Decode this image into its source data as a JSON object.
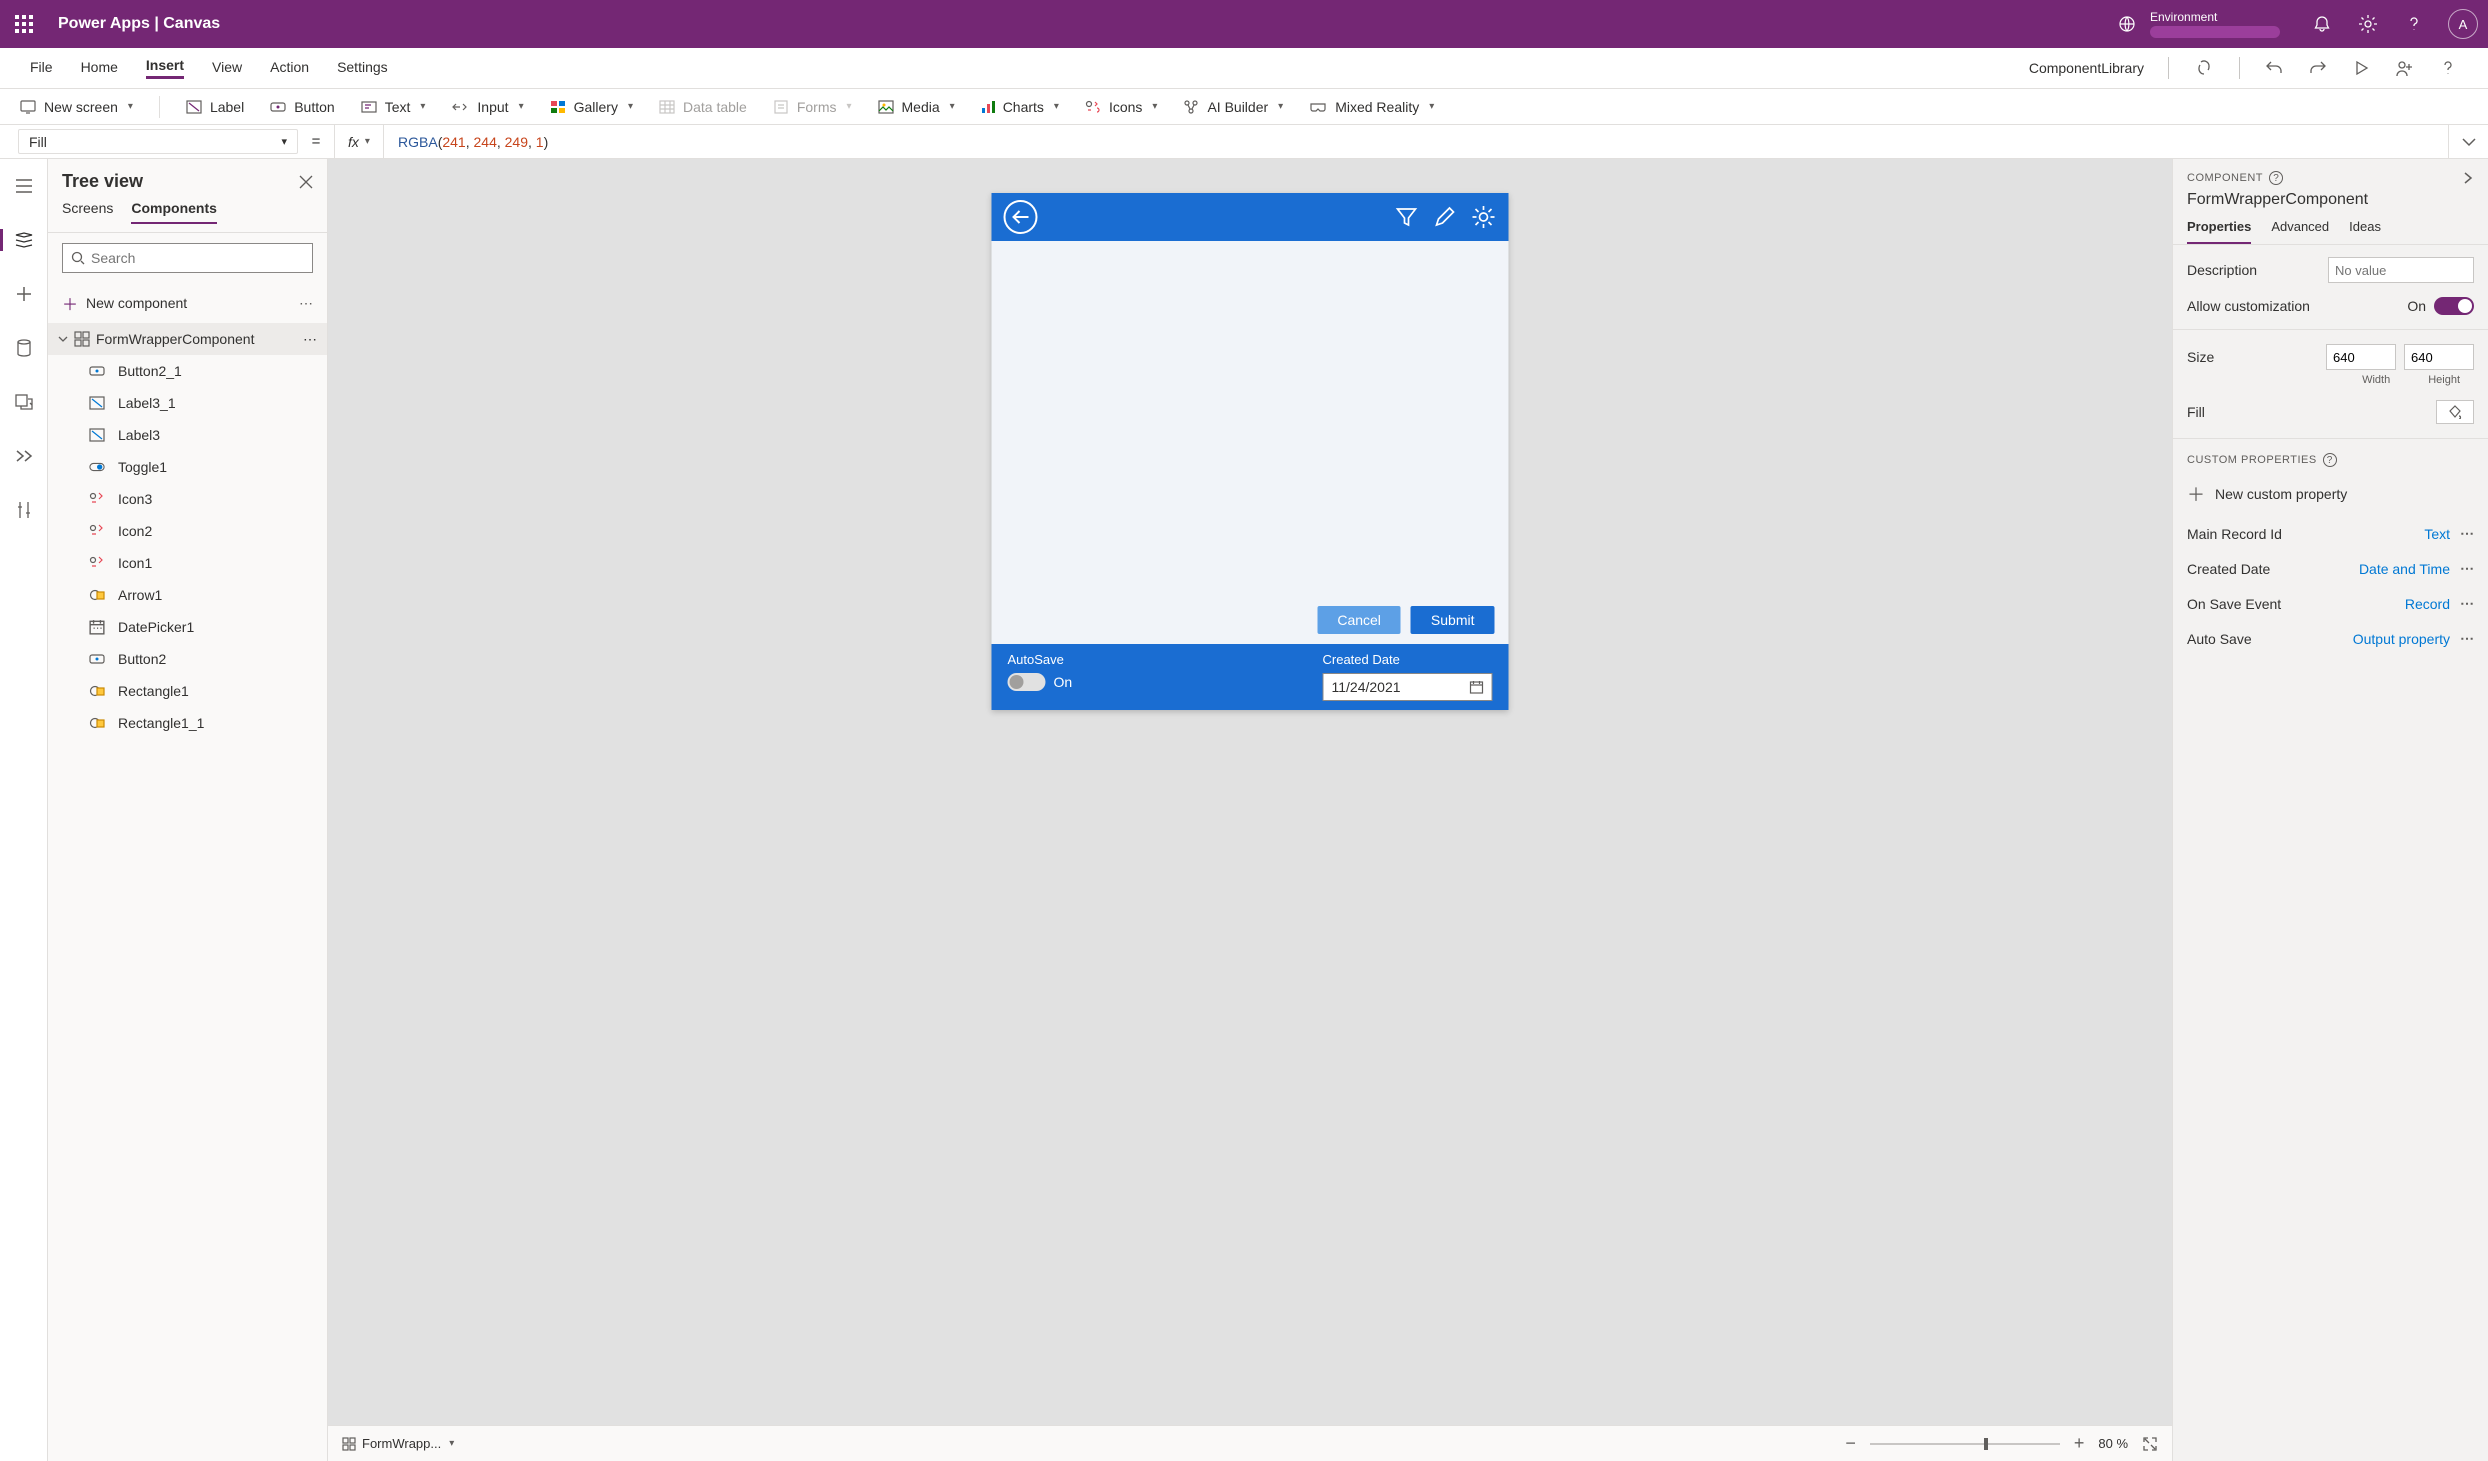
{
  "topbar": {
    "title": "Power Apps  |  Canvas",
    "env_label": "Environment",
    "avatar": "A"
  },
  "menu": {
    "items": [
      "File",
      "Home",
      "Insert",
      "View",
      "Action",
      "Settings"
    ],
    "active": "Insert",
    "component_library": "ComponentLibrary"
  },
  "ribbon": {
    "new_screen": "New screen",
    "label": "Label",
    "button": "Button",
    "text": "Text",
    "input": "Input",
    "gallery": "Gallery",
    "data_table": "Data table",
    "forms": "Forms",
    "media": "Media",
    "charts": "Charts",
    "icons": "Icons",
    "ai_builder": "AI Builder",
    "mixed_reality": "Mixed Reality"
  },
  "formula": {
    "property": "Fill",
    "fx": "fx",
    "fn": "RGBA",
    "args": [
      "241",
      "244",
      "249",
      "1"
    ]
  },
  "tree": {
    "title": "Tree view",
    "tabs": {
      "screens": "Screens",
      "components": "Components"
    },
    "search_placeholder": "Search",
    "new_component": "New component",
    "root": "FormWrapperComponent",
    "children": [
      {
        "name": "Button2_1",
        "icon": "button"
      },
      {
        "name": "Label3_1",
        "icon": "label"
      },
      {
        "name": "Label3",
        "icon": "label"
      },
      {
        "name": "Toggle1",
        "icon": "toggle"
      },
      {
        "name": "Icon3",
        "icon": "icons"
      },
      {
        "name": "Icon2",
        "icon": "icons"
      },
      {
        "name": "Icon1",
        "icon": "icons"
      },
      {
        "name": "Arrow1",
        "icon": "shape"
      },
      {
        "name": "DatePicker1",
        "icon": "date"
      },
      {
        "name": "Button2",
        "icon": "button"
      },
      {
        "name": "Rectangle1",
        "icon": "shape"
      },
      {
        "name": "Rectangle1_1",
        "icon": "shape"
      }
    ]
  },
  "canvas": {
    "buttons": {
      "cancel": "Cancel",
      "submit": "Submit"
    },
    "footer": {
      "autosave_label": "AutoSave",
      "autosave_on": "On",
      "created_label": "Created Date",
      "created_value": "11/24/2021"
    },
    "zoom": "80",
    "zoom_unit": "%",
    "crumb": "FormWrapp..."
  },
  "right": {
    "section": "COMPONENT",
    "name": "FormWrapperComponent",
    "tabs": {
      "properties": "Properties",
      "advanced": "Advanced",
      "ideas": "Ideas"
    },
    "props": {
      "description_label": "Description",
      "description_placeholder": "No value",
      "allow_custom_label": "Allow customization",
      "allow_custom_value": "On",
      "size_label": "Size",
      "size_w": "640",
      "size_h": "640",
      "width_label": "Width",
      "height_label": "Height",
      "fill_label": "Fill"
    },
    "custom_section": "CUSTOM PROPERTIES",
    "new_custom": "New custom property",
    "custom": [
      {
        "name": "Main Record Id",
        "type": "Text"
      },
      {
        "name": "Created Date",
        "type": "Date and Time"
      },
      {
        "name": "On Save Event",
        "type": "Record"
      },
      {
        "name": "Auto Save",
        "type": "Output property"
      }
    ]
  }
}
